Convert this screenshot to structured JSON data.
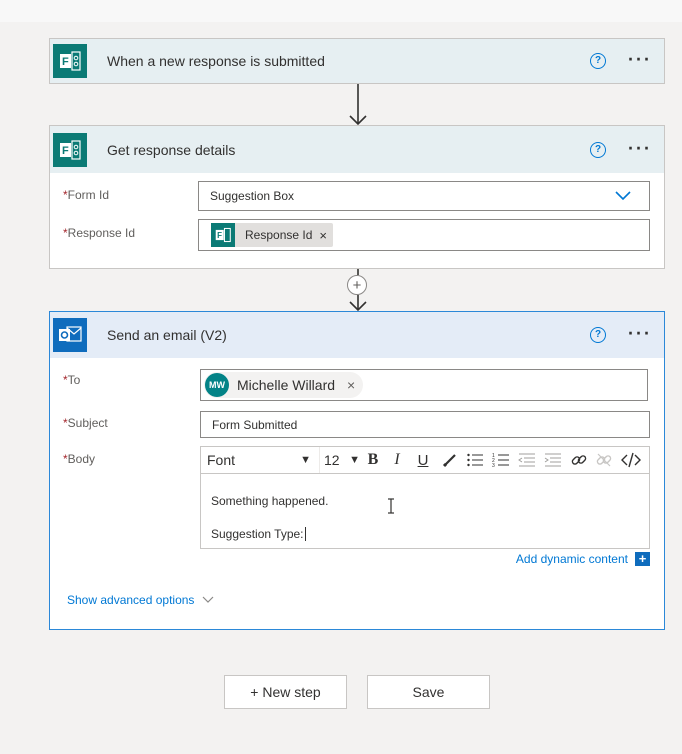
{
  "trigger": {
    "title": "When a new response is submitted",
    "help": "?",
    "more": "···"
  },
  "get_details": {
    "title": "Get response details",
    "help": "?",
    "more": "···",
    "form_id": {
      "label": "Form Id",
      "value": "Suggestion Box"
    },
    "response_id": {
      "label": "Response Id",
      "token": "Response Id",
      "remove": "×"
    }
  },
  "insert_step": "+",
  "send_email": {
    "title": "Send an email (V2)",
    "help": "?",
    "more": "···",
    "to": {
      "label": "To",
      "avatar_initials": "MW",
      "recipient": "Michelle Willard",
      "remove": "×"
    },
    "subject": {
      "label": "Subject",
      "value": "Form Submitted"
    },
    "body": {
      "label": "Body",
      "font": "Font",
      "size": "12",
      "line1": "Something happened.",
      "line2": "Suggestion Type: "
    },
    "dynamic_content": "Add dynamic content",
    "dynamic_content_icon": "+",
    "advanced": "Show advanced options"
  },
  "required_marker": "*",
  "buttons": {
    "new_step": "+ New step",
    "save": "Save"
  },
  "colors": {
    "forms_teal": "#0b7a75",
    "outlook_blue": "#0f6cbd",
    "accent": "#0078d4"
  }
}
